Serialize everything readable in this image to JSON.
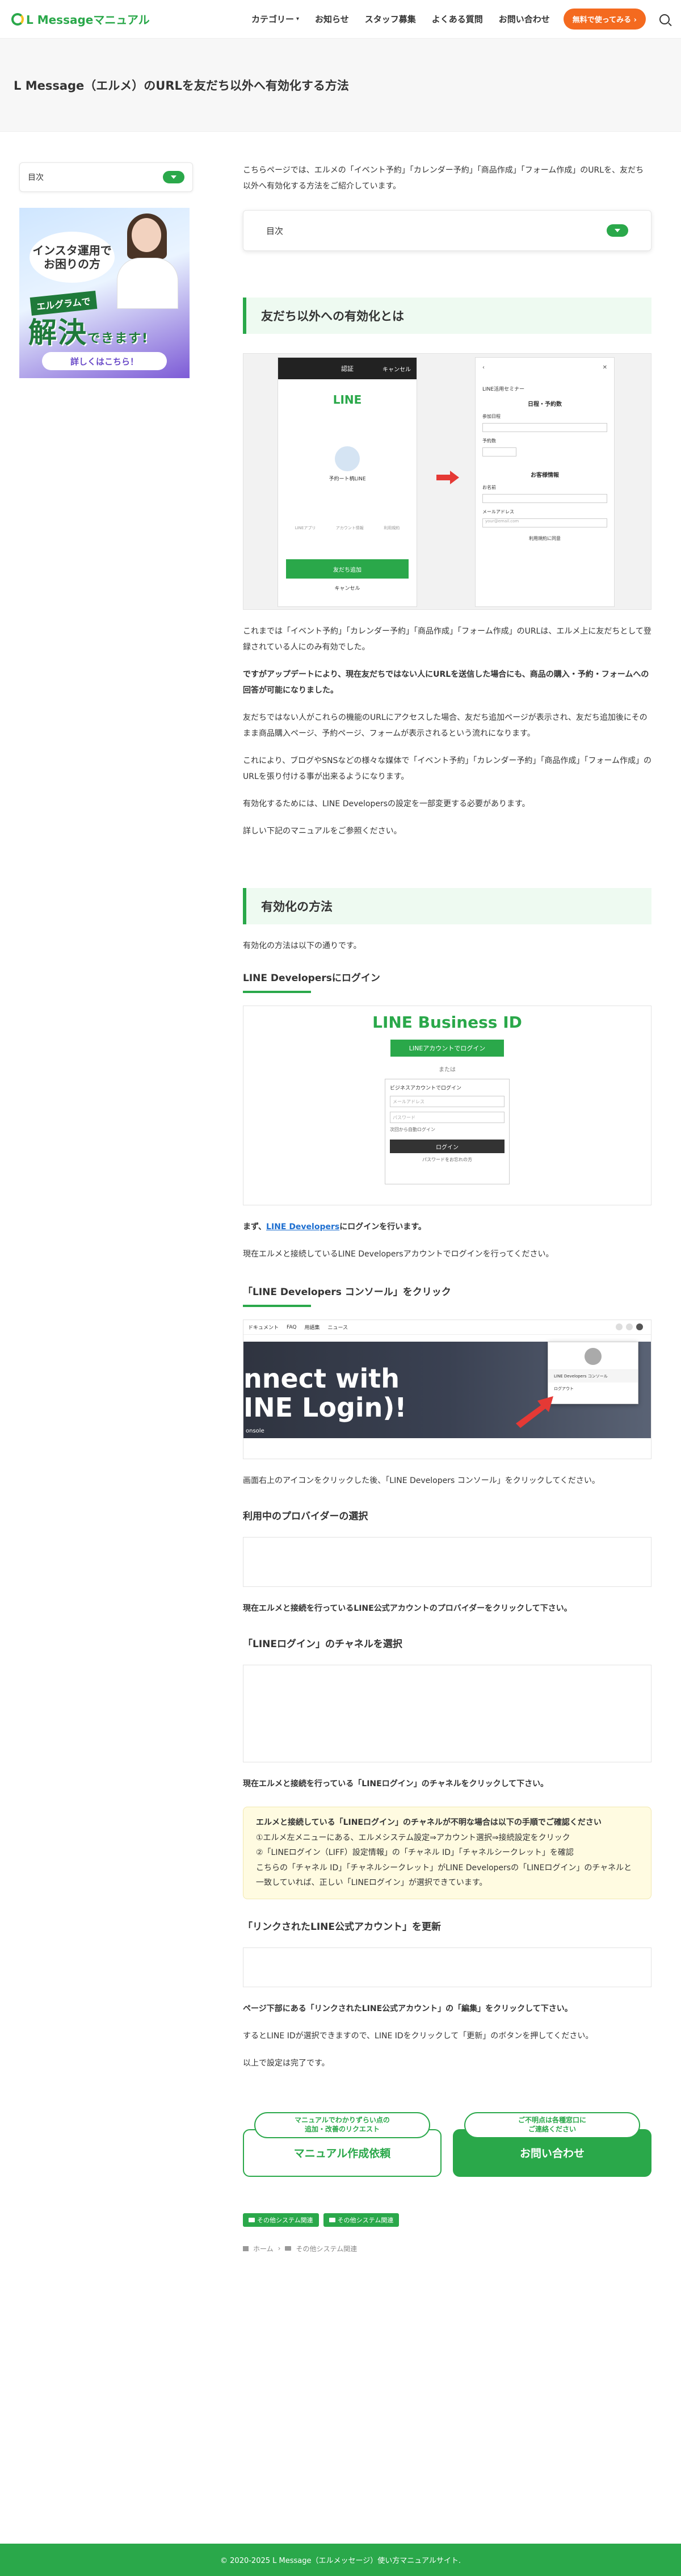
{
  "header": {
    "logo_text": "L Messageマニュアル",
    "nav": [
      "カテゴリー",
      "お知らせ",
      "スタッフ募集",
      "よくある質問",
      "お問い合わせ"
    ],
    "cta": "無料で使ってみる"
  },
  "page": {
    "title": "L Message（エルメ）のURLを友だち以外へ有効化する方法"
  },
  "sidebar": {
    "toc_label": "目次",
    "ad": {
      "bubble": "インスタ運用で\nお困りの方",
      "sub": "エルグラムで",
      "main": "解決",
      "main_suffix": "できます!",
      "button": "詳しくはこちら！"
    }
  },
  "main": {
    "intro": "こちらページでは、エルメの「イベント予約」「カレンダー予約」「商品作成」「フォーム作成」のURLを、友だち以外へ有効化する方法をご紹介しています。",
    "toc_label": "目次",
    "section1": {
      "heading": "友だち以外への有効化とは",
      "shot": {
        "left_title": "認証",
        "left_cancel": "キャンセル",
        "line_logo": "LINE",
        "name": "予約ート柄LINE",
        "links": [
          "LINEアプリ",
          "アカウント情報",
          "利用規約"
        ],
        "green_btn": "友だち追加",
        "cancel": "キャンセル",
        "right_title": "LINE活用セミナー",
        "right_sub": "日程・予約数",
        "right_label1": "参加日程",
        "right_label2": "予約数",
        "right_section": "お客様情報",
        "right_name": "お名前",
        "right_mail": "メールアドレス",
        "right_mail_ph": "your@email.com",
        "right_agree": "利用規約に同意"
      },
      "p1": "これまでは「イベント予約」「カレンダー予約」「商品作成」「フォーム作成」のURLは、エルメ上に友だちとして登録されている人にのみ有効でした。",
      "p2": "ですがアップデートにより、現在友だちではない人にURLを送信した場合にも、商品の購入・予約・フォームへの回答が可能になりました。",
      "p3": "友だちではない人がこれらの機能のURLにアクセスした場合、友だち追加ページが表示され、友だち追加後にそのまま商品購入ページ、予約ページ、フォームが表示されるという流れになります。",
      "p4": "これにより、ブログやSNSなどの様々な媒体で「イベント予約」「カレンダー予約」「商品作成」「フォーム作成」のURLを張り付ける事が出来るようになります。",
      "p5": "有効化するためには、LINE Developersの設定を一部変更する必要があります。",
      "p6": "詳しい下記のマニュアルをご参照ください。"
    },
    "section2": {
      "heading": "有効化の方法",
      "intro": "有効化の方法は以下の通りです。",
      "step1": {
        "title": "LINE Developersにログイン",
        "brand": "LINE Business ID",
        "btn": "LINEアカウントでログイン",
        "or": "または",
        "card_title": "ビジネスアカウントでログイン",
        "email_ph": "メールアドレス",
        "pass_ph": "パスワード",
        "remember": "次回から自動ログイン",
        "login": "ログイン",
        "forgot": "パスワードをお忘れの方",
        "lead": "まず、",
        "link": "LINE Developers",
        "lead_after": "にログインを行います。",
        "p": "現在エルメと接続しているLINE Developersアカウントでログインを行ってください。"
      },
      "step2": {
        "title": "「LINE Developers コンソール」をクリック",
        "nav": [
          "ドキュメント",
          "FAQ",
          "用語集",
          "ニュース"
        ],
        "hero": "nnect with\nINE Login)!",
        "hero_sub": "onsole",
        "menu1": "LINE Developers コンソール",
        "menu2": "ログアウト",
        "p": "画面右上のアイコンをクリックした後、「LINE Developers コンソール」をクリックしてください。"
      },
      "step3": {
        "title": "利用中のプロバイダーの選択",
        "p": "現在エルメと接続を行っているLINE公式アカウントのプロバイダーをクリックして下さい。"
      },
      "step4": {
        "title": "「LINEログイン」のチャネルを選択",
        "p": "現在エルメと接続を行っている「LINEログイン」のチャネルをクリックして下さい。",
        "note_title": "エルメと接続している「LINEログイン」のチャネルが不明な場合は以下の手順でご確認ください",
        "note_1": "①エルメ左メニューにある、エルメシステム設定⇒アカウント選択⇒接続設定をクリック",
        "note_2": "②「LINEログイン（LIFF）設定情報」の「チャネル ID」「チャネルシークレット」を確認",
        "note_3": "こちらの「チャネル ID」「チャネルシークレット」がLINE Developersの「LINEログイン」のチャネルと一致していれば、正しい「LINEログイン」が選択できています。"
      },
      "step5": {
        "title": "「リンクされたLINE公式アカウント」を更新",
        "p1": "ページ下部にある「リンクされたLINE公式アカウント」の「編集」をクリックして下さい。",
        "p2": "するとLINE IDが選択できますので、LINE IDをクリックして「更新」のボタンを押してください。",
        "p3": "以上で設定は完了です。"
      }
    },
    "cta": {
      "left_bubble": "マニュアルでわかりずらい点の\n追加・改善のリクエスト",
      "left_btn": "マニュアル作成依頼",
      "right_bubble": "ご不明点は各種窓口に\nご連絡ください",
      "right_btn": "お問い合わせ"
    },
    "tags": [
      "その他システム関連",
      "その他システム関連"
    ],
    "breadcrumb": [
      "ホーム",
      "その他システム関連"
    ]
  },
  "footer": {
    "copyright": "© 2020-2025 L Message（エルメッセージ）使い方マニュアルサイト."
  },
  "colors": {
    "brand_green": "#2aa84a",
    "cta_orange": "#f46a1f",
    "note_bg": "#fffbe1"
  }
}
